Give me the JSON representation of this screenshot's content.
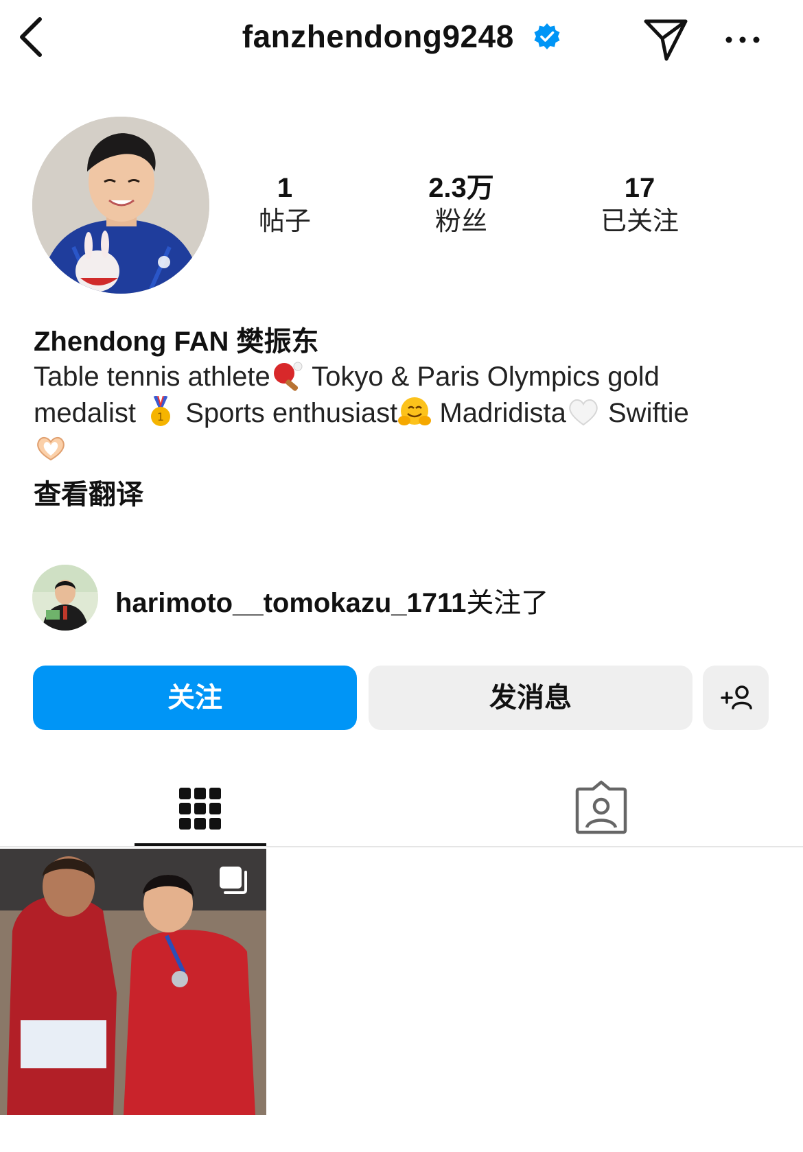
{
  "header": {
    "username": "fanzhendong9248",
    "verified": true,
    "accent_color": "#0095f6"
  },
  "stats": [
    {
      "value": "1",
      "label": "帖子"
    },
    {
      "value": "2.3万",
      "label": "粉丝"
    },
    {
      "value": "17",
      "label": "已关注"
    }
  ],
  "profile": {
    "display_name": "Zhendong FAN 樊振东",
    "bio_parts": {
      "p1": "Table tennis athlete",
      "p2": " Tokyo & Paris Olympics gold",
      "p3": "medalist",
      "p4": " Sports enthusiast",
      "p5": " Madridista",
      "p6": " Swiftie"
    },
    "bio_emojis": [
      "ping-pong",
      "gold-medal",
      "hugging-face",
      "white-heart",
      "heart-hands"
    ],
    "translate_label": "查看翻译"
  },
  "followed_by": {
    "username": "harimoto__tomokazu_1711",
    "suffix": "关注了"
  },
  "actions": {
    "follow_label": "关注",
    "message_label": "发消息"
  },
  "tabs": [
    {
      "icon": "grid-icon",
      "active": true
    },
    {
      "icon": "tagged-icon",
      "active": false
    }
  ],
  "posts": [
    {
      "type": "carousel"
    }
  ]
}
